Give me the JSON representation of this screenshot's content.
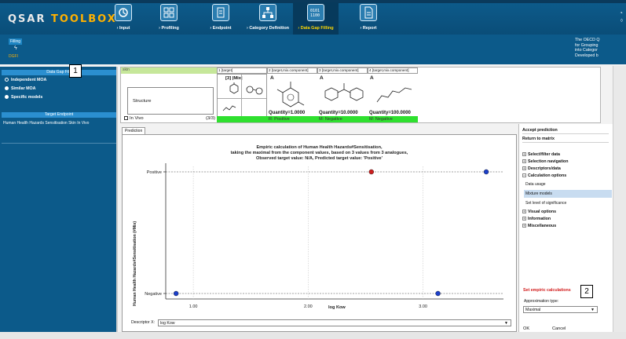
{
  "app": {
    "logo_left": "QSAR ",
    "logo_right": "TOOLBOX",
    "colors": {
      "header": "#0d5c8c",
      "accent": "#ffb100",
      "active_nav": "#ffd800",
      "green": "#2fe02f",
      "red_dot": "#cc1f1f",
      "blue_dot": "#1c3fc9"
    }
  },
  "nav": [
    {
      "label": "› Input",
      "icon": "input-icon"
    },
    {
      "label": "› Profiling",
      "icon": "profiling-icon"
    },
    {
      "label": "› Endpoint",
      "icon": "endpoint-icon"
    },
    {
      "label": "› Category Definition",
      "icon": "category-icon"
    },
    {
      "label": "› Data Gap Filling",
      "icon": "data-gap-icon",
      "active": true
    },
    {
      "label": "› Report",
      "icon": "report-icon"
    }
  ],
  "subheader": {
    "filling": "Filling",
    "gap_label": "DGFI",
    "oecd_lines": [
      "The OECD Q",
      "for Grouping",
      "into Categor",
      "Developed b"
    ]
  },
  "left_panel": {
    "header": "Data Gap Filli",
    "items": [
      "Independent MOA",
      "Similar MOA",
      "Specific models"
    ],
    "target_endpoint_header": "Target Endpoint",
    "endpoint": "Human Health Hazards Sensitisation Skin In Vivo"
  },
  "callouts": [
    "1",
    "2"
  ],
  "matrix": {
    "skin": "skin",
    "columns": [
      "1 [target]",
      "2 [target,mix.component]",
      "3 [target,mix.component]",
      "4 [target,mix.component]"
    ],
    "structure": "Structure",
    "col1_label": "[3] |Mix|",
    "col_letters": [
      "A",
      "A",
      "A"
    ],
    "invivo": "In Vivo",
    "invivo_count": "(3/3)",
    "quantities": [
      "Quantity=1.0000",
      "Quantity=10.0000",
      "Quantity=100.0000"
    ],
    "results": [
      "R: Positive",
      "M: Negative",
      "M: Negative"
    ]
  },
  "prediction_tab": "Prediction",
  "chart_data": {
    "type": "scatter",
    "title_lines": [
      "Empiric calculation of Human Health Hazards#Sensitisation,",
      "taking the maximal from the component values, based on 3 values from 3 analogues,",
      "Observed target value: N/A, Predicted target value: 'Positive'"
    ],
    "xlabel": "log Kow",
    "ylabel": "Human Health Hazards#Sensitisation (#Mix)",
    "categories_y": [
      "Negative",
      "Positive"
    ],
    "x_ticks": [
      "1.00",
      "2.00",
      "3.00"
    ],
    "xlim": [
      0.76,
      3.7
    ],
    "points": [
      {
        "x": 0.85,
        "y": "Negative",
        "color": "blue"
      },
      {
        "x": 3.13,
        "y": "Negative",
        "color": "blue"
      },
      {
        "x": 2.55,
        "y": "Positive",
        "color": "red"
      },
      {
        "x": 3.55,
        "y": "Positive",
        "color": "blue"
      }
    ],
    "grid": true
  },
  "descriptor": {
    "label": "Descriptor X:",
    "value": "log Kow"
  },
  "right_panel": {
    "accept": "Accept prediction",
    "return": "Return to matrix",
    "sections": [
      {
        "sign": "+",
        "label": "Select/filter data"
      },
      {
        "sign": "+",
        "label": "Selection navigation"
      },
      {
        "sign": "+",
        "label": "Descriptors/data"
      },
      {
        "sign": "−",
        "label": "Calculation options"
      }
    ],
    "sub_items": [
      "Data usage",
      "Mixture models",
      "Set level of significance"
    ],
    "sections2": [
      {
        "sign": "+",
        "label": "Visual options"
      },
      {
        "sign": "+",
        "label": "Information"
      },
      {
        "sign": "+",
        "label": "Miscellaneous"
      }
    ],
    "set_empiric": "Set empiric calculations",
    "approx_label": "Approximation type:",
    "approx_value": "Maximal",
    "ok": "OK",
    "cancel": "Cancel"
  }
}
